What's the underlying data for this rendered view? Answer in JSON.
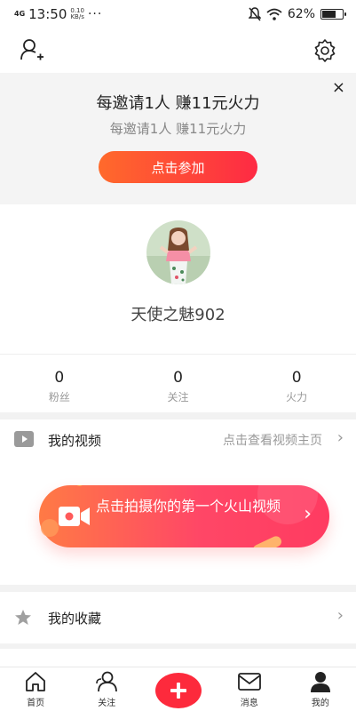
{
  "status_bar": {
    "network": "4G",
    "time": "13:50",
    "speed_value": "0.10",
    "speed_unit": "KB/s",
    "more": "···",
    "battery": "62%"
  },
  "invite": {
    "title": "每邀请1人 赚11元火力",
    "subtitle": "每邀请1人 赚11元火力",
    "button": "点击参加",
    "close": "×"
  },
  "profile": {
    "nickname": "天使之魅902"
  },
  "stats": [
    {
      "value": "0",
      "label": "粉丝"
    },
    {
      "value": "0",
      "label": "关注"
    },
    {
      "value": "0",
      "label": "火力"
    }
  ],
  "video": {
    "title": "我的视频",
    "hint": "点击查看视频主页",
    "cta": "点击拍摄你的第一个火山视频"
  },
  "favorites": {
    "title": "我的收藏"
  },
  "tabs": [
    {
      "label": "首页"
    },
    {
      "label": "关注"
    },
    {
      "label": ""
    },
    {
      "label": "消息"
    },
    {
      "label": "我的"
    }
  ],
  "colors": {
    "accent": "#fd2a3c",
    "gradient_start": "#ff6a2b",
    "gradient_end": "#fe2a44"
  }
}
